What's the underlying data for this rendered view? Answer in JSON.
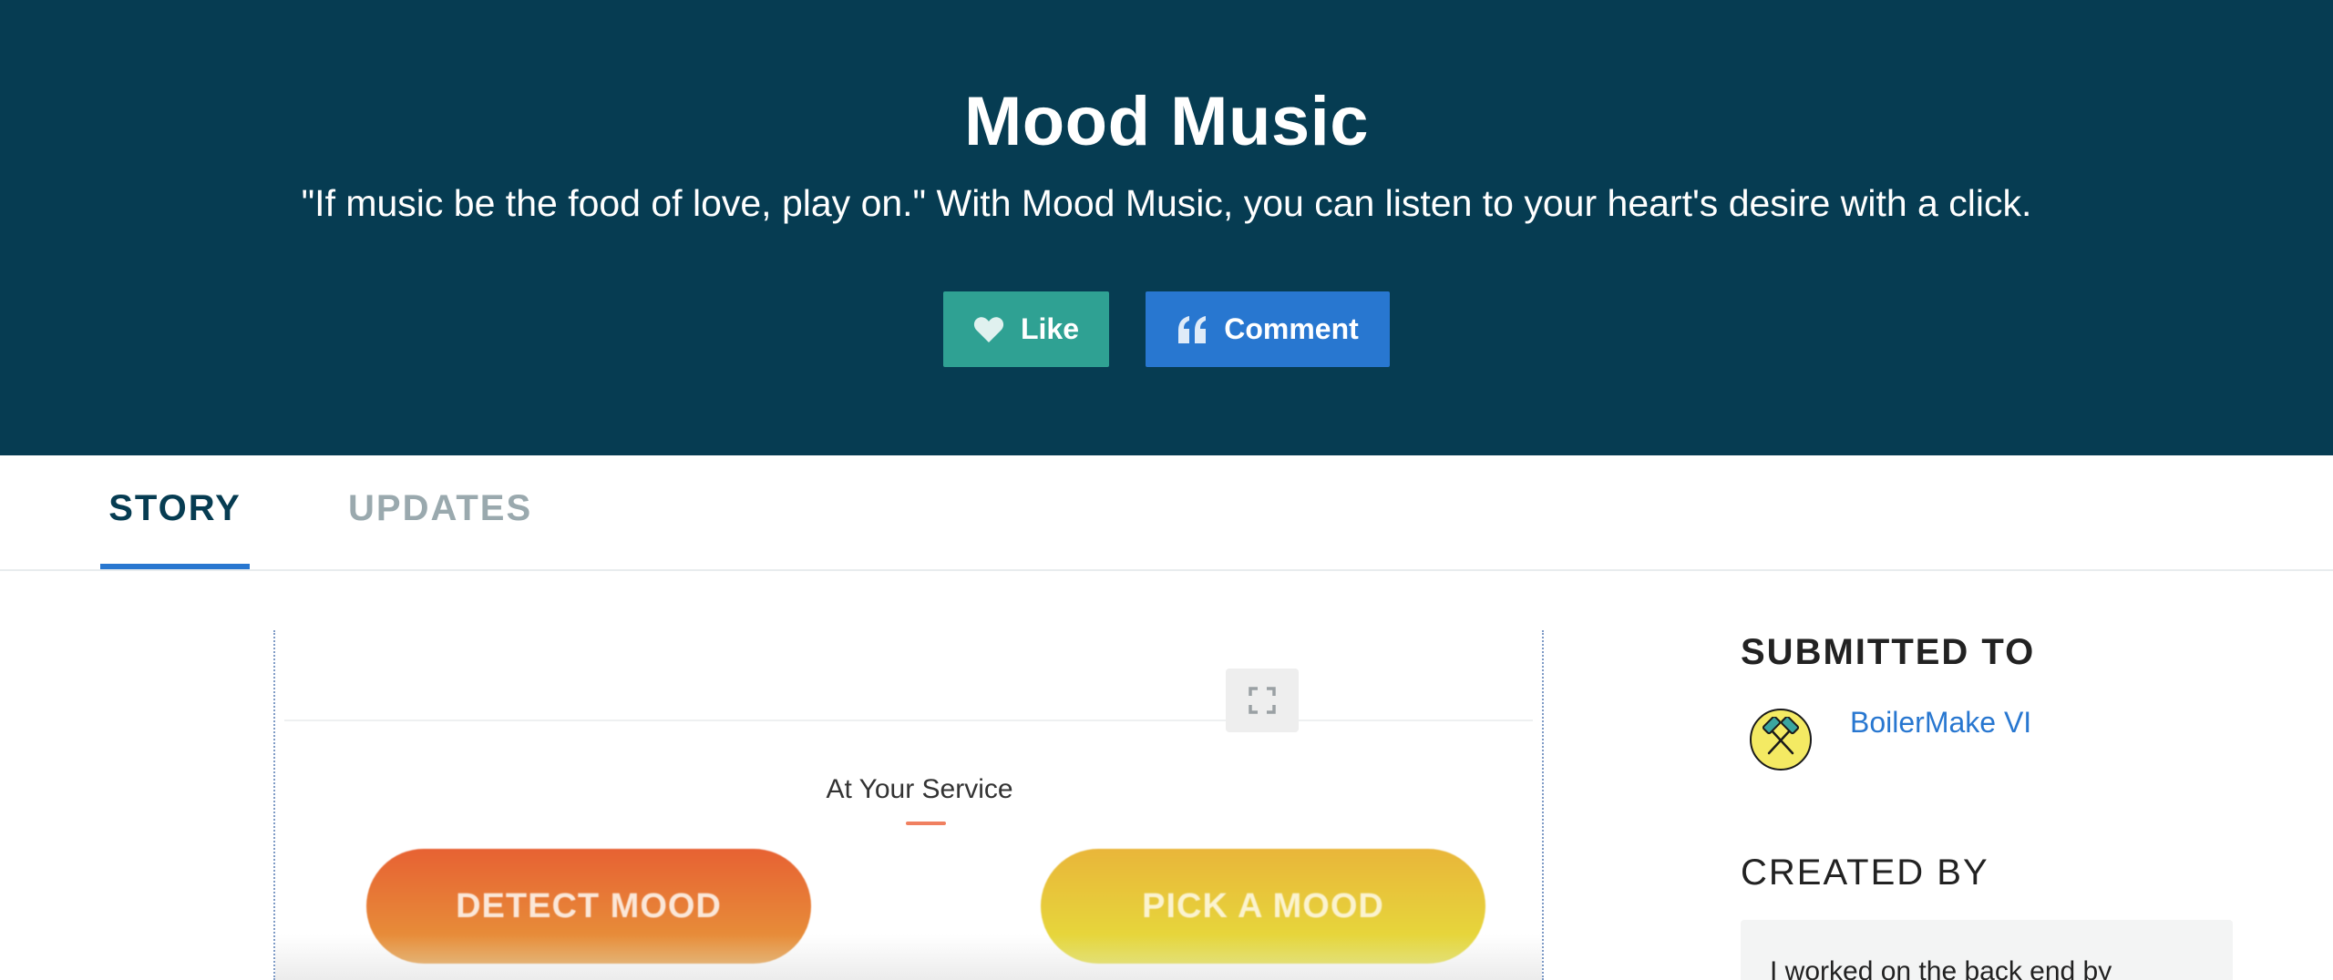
{
  "project": {
    "title": "Mood Music",
    "tagline": "\"If music be the food of love, play on.\" With Mood Music, you can listen to your heart's desire with a click."
  },
  "actions": {
    "like_label": "Like",
    "comment_label": "Comment",
    "like_icon": "heart-icon",
    "comment_icon": "quote-icon"
  },
  "tabs": [
    {
      "label": "STORY",
      "active": true
    },
    {
      "label": "UPDATES",
      "active": false
    }
  ],
  "embed": {
    "section_title": "At Your Service",
    "buttons": [
      {
        "label": "DETECT MOOD"
      },
      {
        "label": "PICK A MOOD"
      }
    ],
    "expand_icon": "expand-icon"
  },
  "sidebar": {
    "submitted_heading": "SUBMITTED TO",
    "event_name": "BoilerMake VI",
    "created_heading": "CREATED BY",
    "created_text": "I worked on the back end by"
  },
  "colors": {
    "header_bg": "#063c52",
    "like_bg": "#2fa193",
    "comment_bg": "#2877d0",
    "active_tab_underline": "#2877d0"
  }
}
